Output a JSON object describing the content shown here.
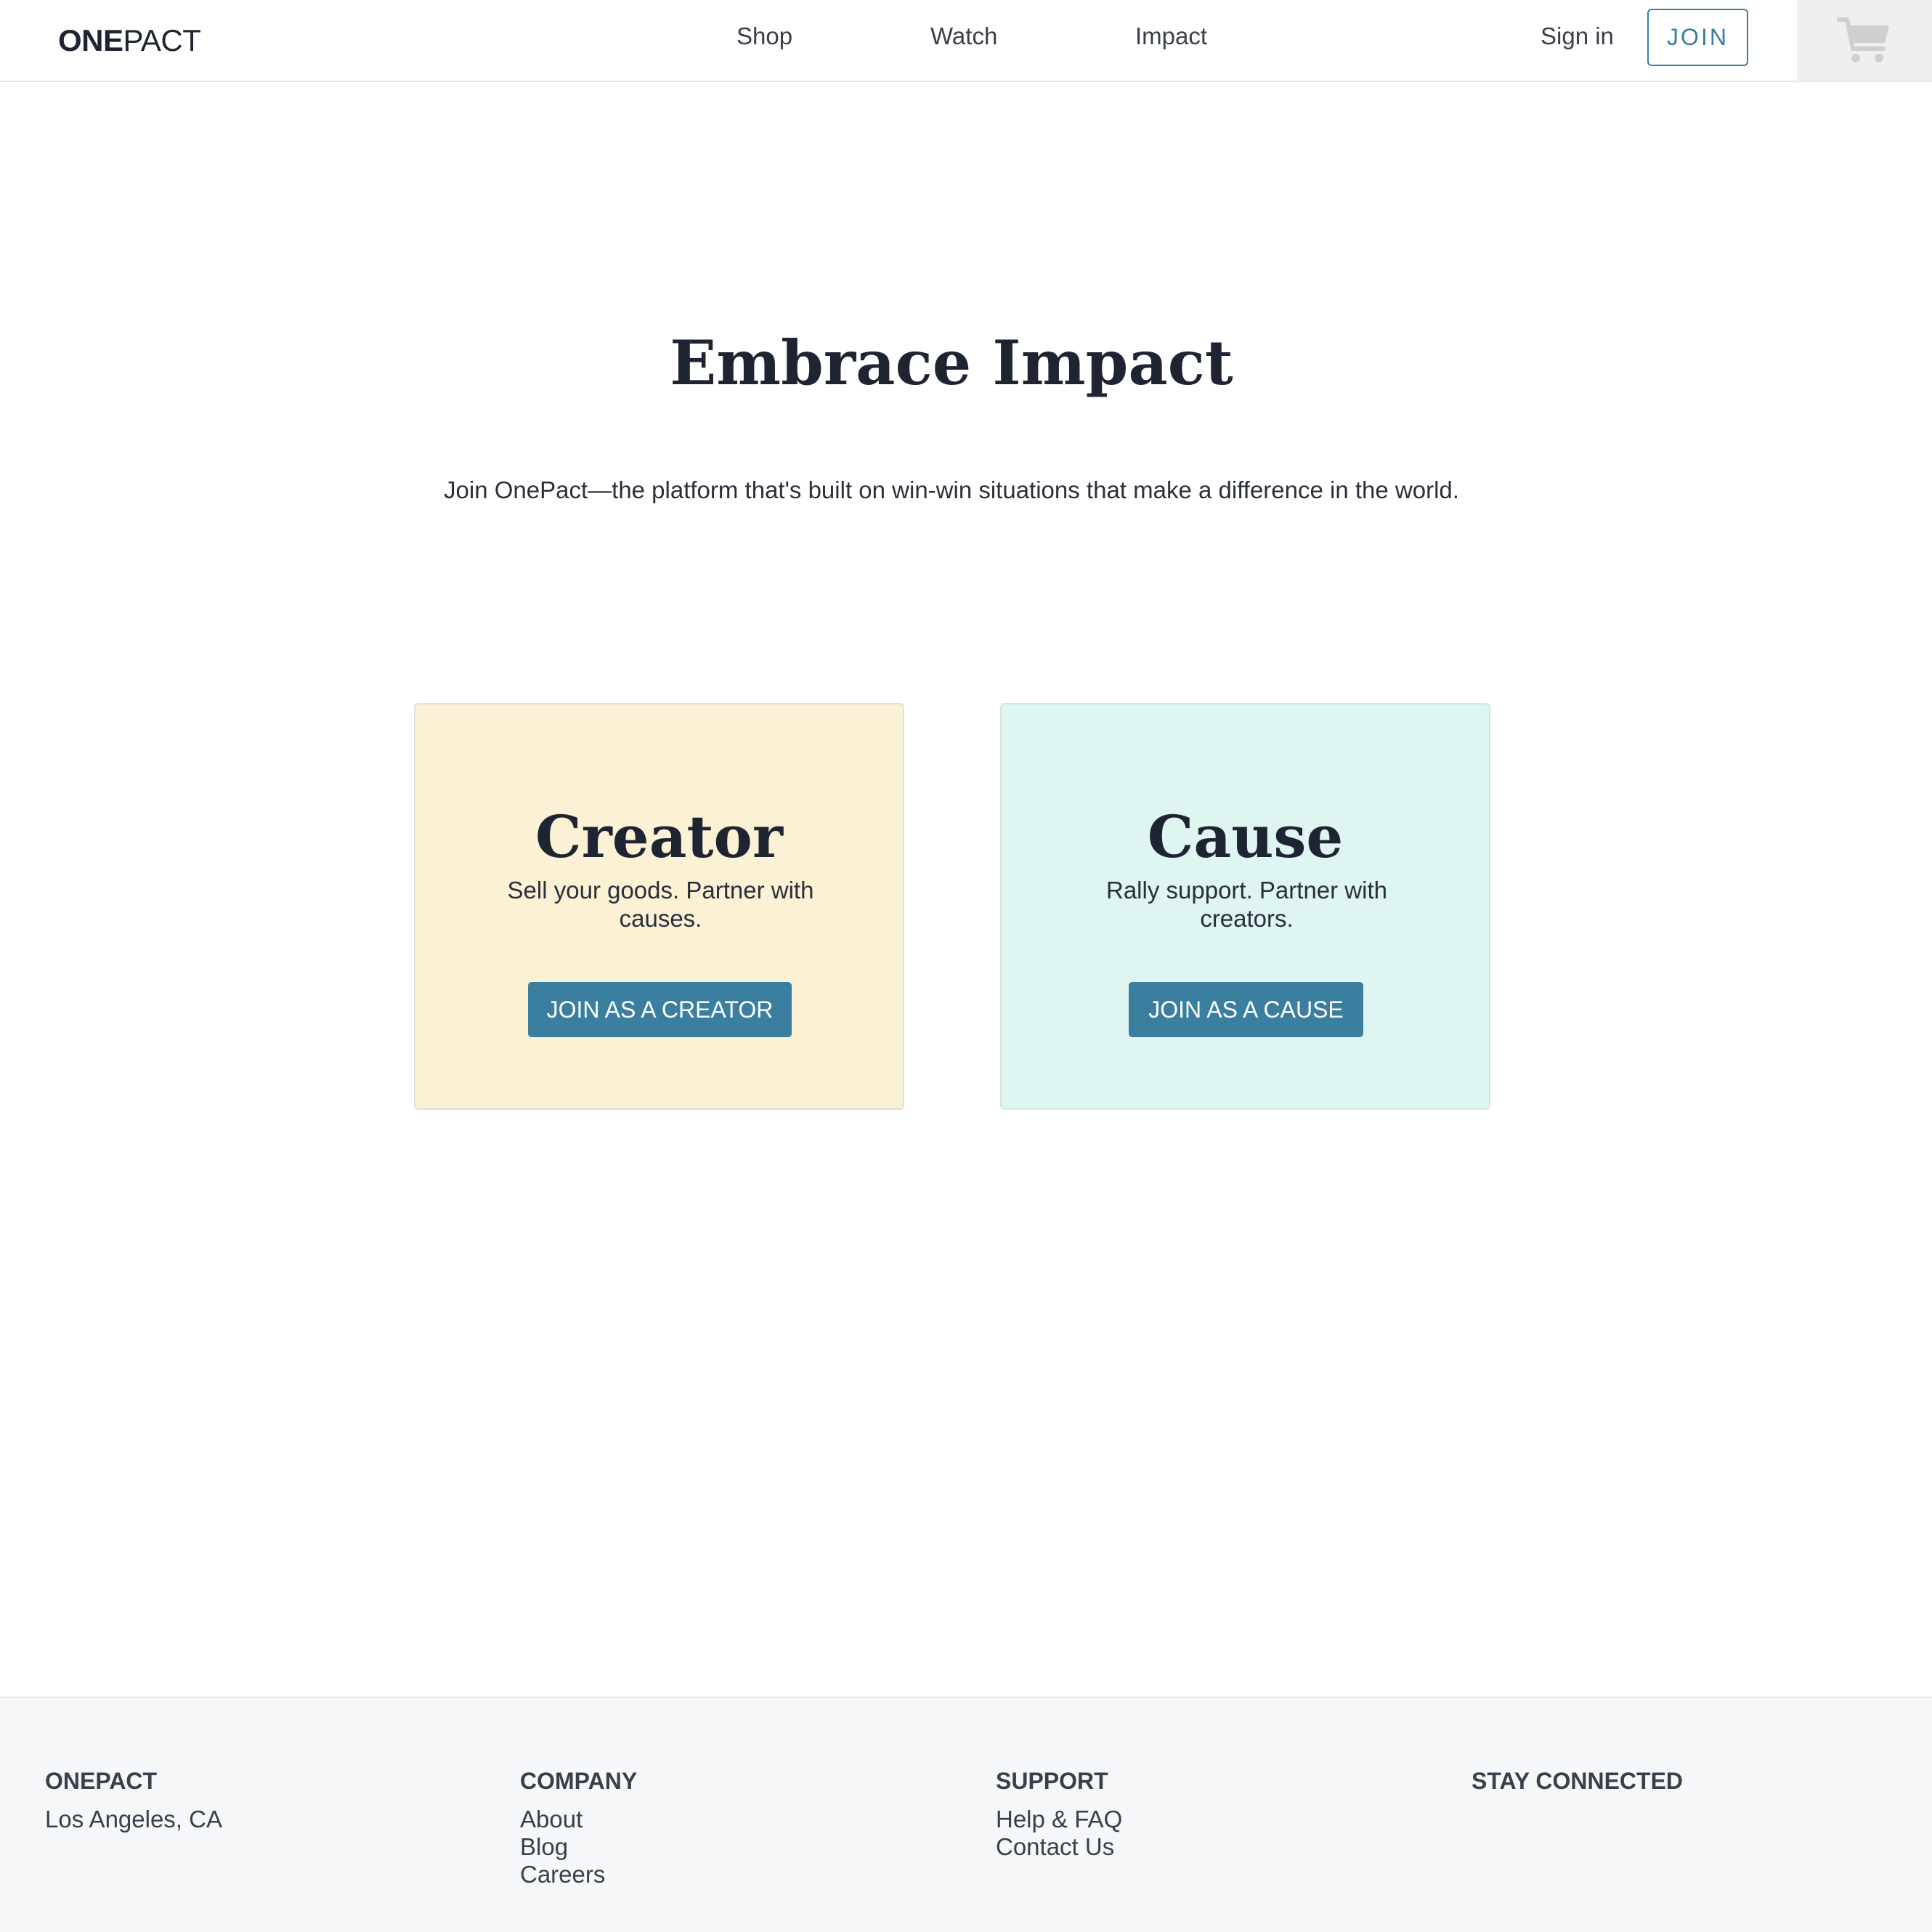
{
  "header": {
    "logo_bold": "ONE",
    "logo_light": "PACT",
    "nav": [
      {
        "label": "Shop"
      },
      {
        "label": "Watch"
      },
      {
        "label": "Impact"
      }
    ],
    "signin_label": "Sign in",
    "join_label": "JOIN",
    "cart_icon": "cart-icon"
  },
  "hero": {
    "title": "Embrace Impact",
    "subtitle": "Join OnePact—the platform that's built on win-win situations that make a difference in the world."
  },
  "cards": [
    {
      "title": "Creator",
      "description": "Sell your goods. Partner with causes.",
      "button_label": "JOIN AS A CREATOR",
      "background": "#fbf1d4"
    },
    {
      "title": "Cause",
      "description": "Rally support. Partner with creators.",
      "button_label": "JOIN AS A CAUSE",
      "background": "#dff5f2"
    }
  ],
  "footer": {
    "columns": [
      {
        "heading": "ONEPACT",
        "items": [
          "Los Angeles, CA"
        ]
      },
      {
        "heading": "COMPANY",
        "items": [
          "About",
          "Blog",
          "Careers"
        ]
      },
      {
        "heading": "SUPPORT",
        "items": [
          "Help & FAQ",
          "Contact Us"
        ]
      },
      {
        "heading": "STAY CONNECTED",
        "items": []
      }
    ]
  },
  "colors": {
    "accent": "#3a7fa0",
    "text_dark": "#1f2433",
    "footer_bg": "#f6f7f9",
    "cart_bg": "#efefef"
  }
}
